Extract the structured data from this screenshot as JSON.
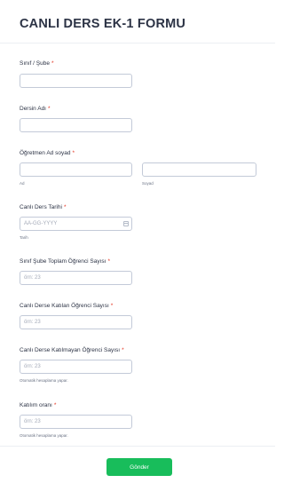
{
  "form": {
    "title": "CANLI DERS EK-1 FORMU",
    "required_mark": "*",
    "fields": {
      "sinif_sube": {
        "label": "Sınıf / Şube"
      },
      "dersin_adi": {
        "label": "Dersin Adı"
      },
      "ogretmen": {
        "label": "Öğretmen Ad soyad",
        "first_sublabel": "Ad",
        "last_sublabel": "Soyad"
      },
      "tarih": {
        "label": "Canlı Ders Tarihi",
        "placeholder": "AA-GG-YYYY",
        "sublabel": "Tarih"
      },
      "toplam": {
        "label": "Sınıf Şube Toplam Öğrenci Sayısı",
        "placeholder": "örn: 23"
      },
      "katilan": {
        "label": "Canlı Derse Katılan Öğrenci Sayısı",
        "placeholder": "örn: 23"
      },
      "katilmayan": {
        "label": "Canlı Derse Katılmayan Öğrenci Sayısı",
        "placeholder": "örn: 23",
        "sublabel": "Otomatik hesaplama yapar."
      },
      "oran": {
        "label": "Katılım oranı",
        "placeholder": "örn: 23",
        "sublabel": "Otomatik hesaplama yapar."
      }
    },
    "submit_label": "Gönder"
  },
  "colors": {
    "accent": "#18bd5b",
    "required": "#e4321e"
  }
}
